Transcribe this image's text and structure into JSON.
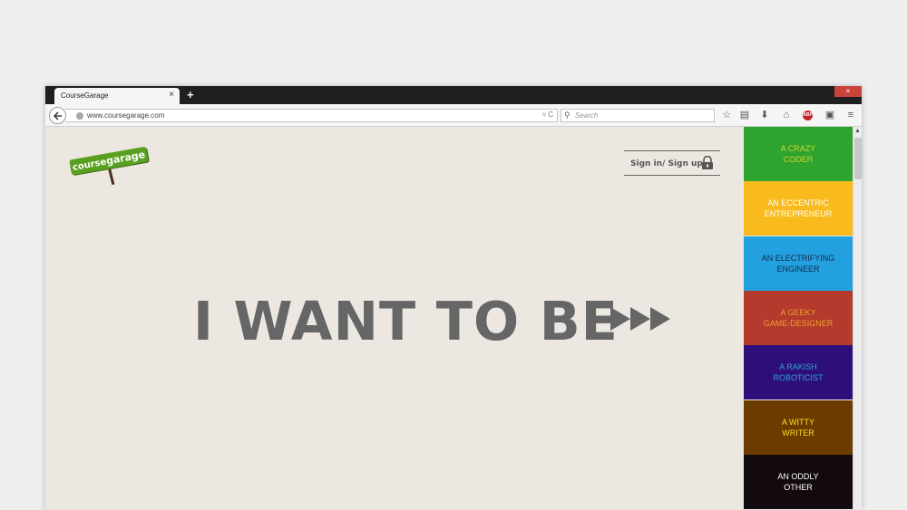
{
  "browser": {
    "tab_title": "CourseGarage",
    "tab_close": "×",
    "new_tab": "+",
    "window_close": "×",
    "url": "www.coursegarage.com",
    "url_actions": "▿ C",
    "search_placeholder": "Search"
  },
  "logo": {
    "word_course": "course",
    "word_garage": "garage"
  },
  "header": {
    "signin_label": "Sign in/ Sign up"
  },
  "main": {
    "headline": "I WANT TO BE"
  },
  "sidemenu": {
    "items": [
      {
        "label": "A CRAZY\nCODER",
        "bg": "#2ea32e",
        "fg": "#c9d63a"
      },
      {
        "label": "AN ECCENTRIC\nENTREPRENEUR",
        "bg": "#f8ba1c",
        "fg": "#ffffff"
      },
      {
        "label": "AN ELECTRIFYING\nENGINEER",
        "bg": "#22a0df",
        "fg": "#1b2a4a"
      },
      {
        "label": "A GEEKY\nGAME-DESIGNER",
        "bg": "#b33a2c",
        "fg": "#f0a030"
      },
      {
        "label": "A RAKISH\nROBOTICIST",
        "bg": "#2e0f7a",
        "fg": "#2aa7c9"
      },
      {
        "label": "A WITTY\nWRITER",
        "bg": "#6b3b00",
        "fg": "#f4e020"
      },
      {
        "label": "AN ODDLY\nOTHER",
        "bg": "#130a10",
        "fg": "#ffffff"
      }
    ]
  },
  "colors": {
    "page_bg": "#ece8e1",
    "headline": "#666666",
    "logo_green": "#5aa020"
  }
}
